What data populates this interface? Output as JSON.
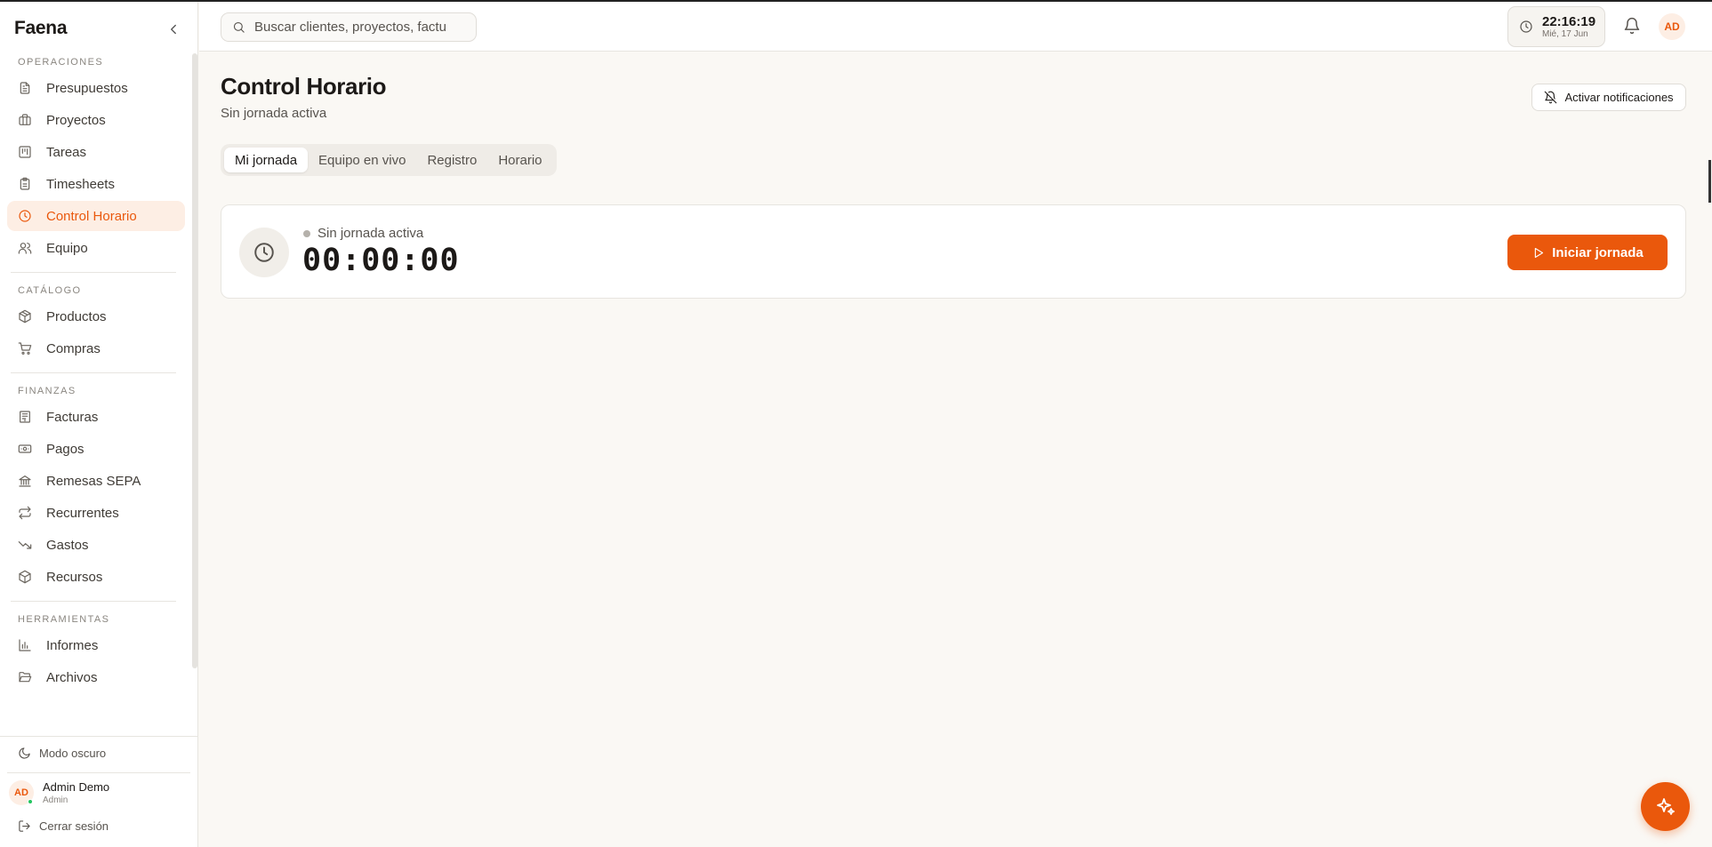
{
  "app": {
    "brand": "Faena"
  },
  "sidebar": {
    "sections": [
      {
        "label": "OPERACIONES",
        "items": [
          {
            "label": "Presupuestos",
            "icon": "file-text-icon"
          },
          {
            "label": "Proyectos",
            "icon": "briefcase-icon"
          },
          {
            "label": "Tareas",
            "icon": "kanban-icon"
          },
          {
            "label": "Timesheets",
            "icon": "clipboard-icon"
          },
          {
            "label": "Control Horario",
            "icon": "clock-icon",
            "active": true
          },
          {
            "label": "Equipo",
            "icon": "users-icon"
          }
        ]
      },
      {
        "label": "CATÁLOGO",
        "items": [
          {
            "label": "Productos",
            "icon": "package-icon"
          },
          {
            "label": "Compras",
            "icon": "cart-icon"
          }
        ]
      },
      {
        "label": "FINANZAS",
        "items": [
          {
            "label": "Facturas",
            "icon": "receipt-icon"
          },
          {
            "label": "Pagos",
            "icon": "banknote-icon"
          },
          {
            "label": "Remesas SEPA",
            "icon": "bank-icon"
          },
          {
            "label": "Recurrentes",
            "icon": "repeat-icon"
          },
          {
            "label": "Gastos",
            "icon": "trending-down-icon"
          },
          {
            "label": "Recursos",
            "icon": "box-icon"
          }
        ]
      },
      {
        "label": "HERRAMIENTAS",
        "items": [
          {
            "label": "Informes",
            "icon": "bar-chart-icon"
          },
          {
            "label": "Archivos",
            "icon": "folder-open-icon"
          }
        ]
      }
    ],
    "footer": {
      "dark_mode": "Modo oscuro",
      "user_initials": "AD",
      "user_name": "Admin Demo",
      "user_role": "Admin",
      "logout": "Cerrar sesión"
    }
  },
  "topbar": {
    "search_placeholder": "Buscar clientes, proyectos, factu",
    "clock_time": "22:16:19",
    "clock_date": "Mié, 17 Jun",
    "avatar_initials": "AD"
  },
  "main": {
    "title": "Control Horario",
    "subtitle": "Sin jornada activa",
    "notif_button": "Activar notificaciones",
    "tabs": [
      {
        "label": "Mi jornada",
        "active": true
      },
      {
        "label": "Equipo en vivo"
      },
      {
        "label": "Registro"
      },
      {
        "label": "Horario"
      }
    ],
    "card": {
      "status": "Sin jornada activa",
      "timer": "00:00:00",
      "start_button": "Iniciar jornada"
    }
  },
  "colors": {
    "accent": "#ea580c",
    "active_bg": "#fdeee4",
    "background": "#faf8f4"
  }
}
